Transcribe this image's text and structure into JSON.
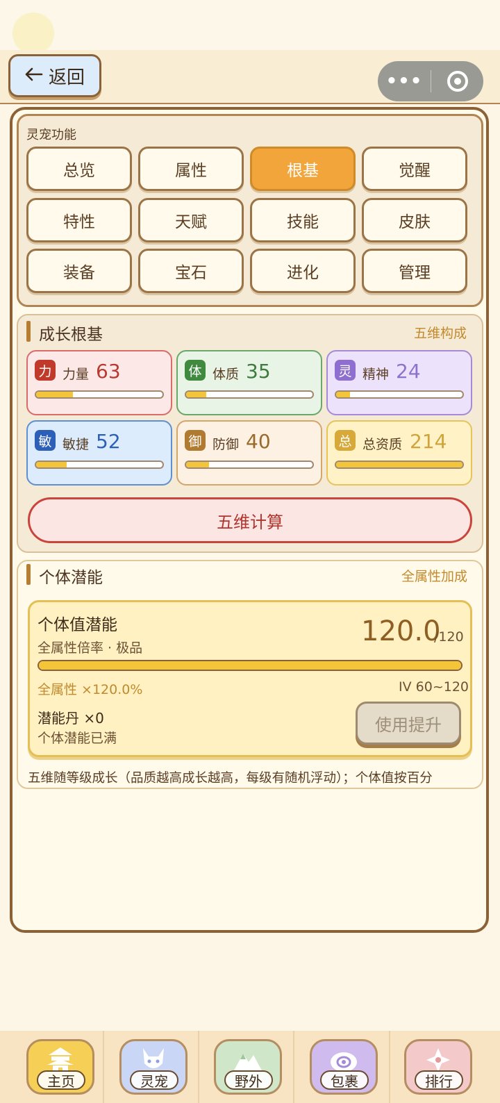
{
  "colors": {
    "accent": "#f2a53b",
    "frame": "#8b6238",
    "danger": "#c9443d",
    "gold": "#f2c53a"
  },
  "nav": {
    "back_label": "返回",
    "back_icon": "arrow-left-icon",
    "more_icon": "more-dots-icon",
    "close_icon": "target-icon"
  },
  "functions": {
    "title": "灵宠功能",
    "active": "根基",
    "buttons": [
      "总览",
      "属性",
      "根基",
      "觉醒",
      "特性",
      "天赋",
      "技能",
      "皮肤",
      "装备",
      "宝石",
      "进化",
      "管理"
    ]
  },
  "growth": {
    "title": "成长根基",
    "link": "五维构成",
    "stats": [
      {
        "badge": "力",
        "name": "力量",
        "value": "63",
        "fill": 0.29
      },
      {
        "badge": "体",
        "name": "体质",
        "value": "35",
        "fill": 0.16
      },
      {
        "badge": "灵",
        "name": "精神",
        "value": "24",
        "fill": 0.11
      },
      {
        "badge": "敏",
        "name": "敏捷",
        "value": "52",
        "fill": 0.24
      },
      {
        "badge": "御",
        "name": "防御",
        "value": "40",
        "fill": 0.18
      },
      {
        "badge": "总",
        "name": "总资质",
        "value": "214",
        "fill": 1.0
      }
    ],
    "calc_button": "五维计算"
  },
  "potential": {
    "title": "个体潜能",
    "link": "全属性加成",
    "card_title": "个体值潜能",
    "card_sub": "全属性倍率 · 极品",
    "value": "120.0",
    "max": "/120",
    "fill": 1.0,
    "all_attr": "全属性 ×120.0%",
    "iv_range": "IV 60~120",
    "pill": "潜能丹 ×0",
    "status": "个体潜能已满",
    "use_button": "使用提升",
    "note": "五维随等级成长（品质越高成长越高，每级有随机浮动）；个体值按百分"
  },
  "tabs": [
    {
      "label": "主页",
      "icon": "pagoda-icon"
    },
    {
      "label": "灵宠",
      "icon": "fox-icon"
    },
    {
      "label": "野外",
      "icon": "mountain-icon"
    },
    {
      "label": "包裹",
      "icon": "bag-icon"
    },
    {
      "label": "排行",
      "icon": "flower-icon"
    }
  ]
}
